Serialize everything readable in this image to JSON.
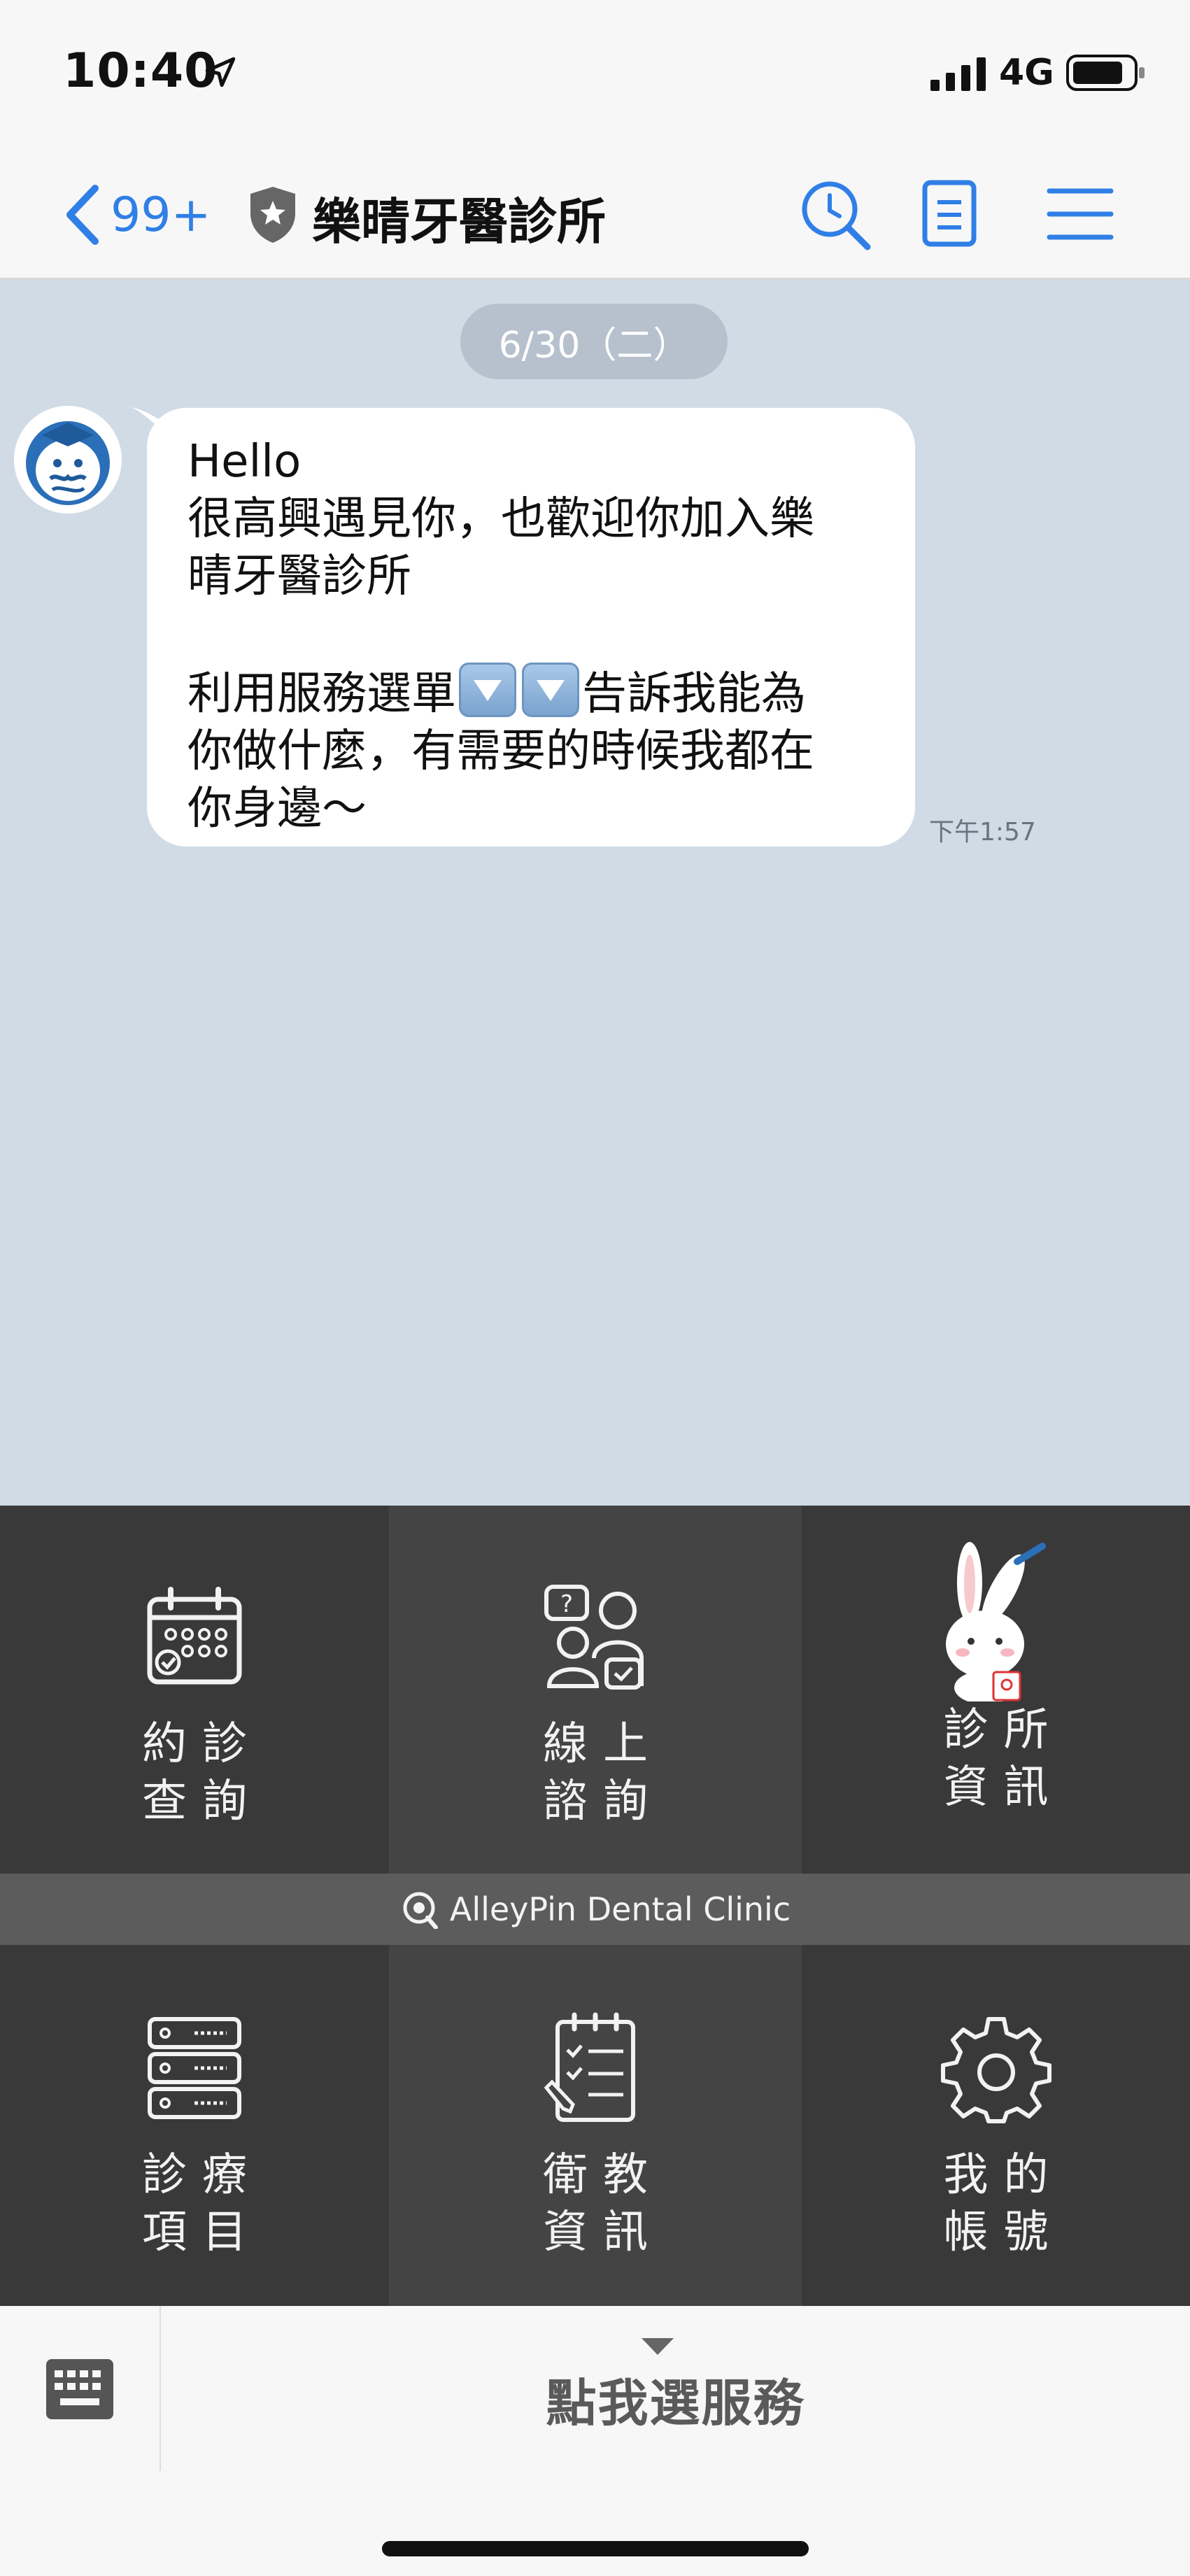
{
  "status_bar": {
    "time": "10:40",
    "network": "4G"
  },
  "nav": {
    "back_count": "99+",
    "title": "樂晴牙醫診所"
  },
  "chat": {
    "date_label": "6/30（二）",
    "message": {
      "lines": [
        "Hello",
        "很高興遇見你，也歡迎你加入樂",
        "晴牙醫診所",
        "",
        "",
        "你做什麼，有需要的時候我都在",
        "你身邊～"
      ],
      "line5_before": "利用服務選單",
      "line5_after": "告訴我能為",
      "time": "下午1:57"
    }
  },
  "rich_menu": {
    "banner": "AlleyPin Dental Clinic",
    "tiles": [
      {
        "line1": "約診",
        "line2": "查詢",
        "icon": "calendar-icon"
      },
      {
        "line1": "線上",
        "line2": "諮詢",
        "icon": "consult-icon"
      },
      {
        "line1": "診所",
        "line2": "資訊",
        "icon": "rabbit-mascot-icon"
      },
      {
        "line1": "診療",
        "line2": "項目",
        "icon": "list-icon"
      },
      {
        "line1": "衛教",
        "line2": "資訊",
        "icon": "clipboard-icon"
      },
      {
        "line1": "我的",
        "line2": "帳號",
        "icon": "gear-icon"
      }
    ]
  },
  "bottom_bar": {
    "service_label": "點我選服務"
  },
  "colors": {
    "accent_blue": "#2f7fe6",
    "chat_bg": "#d0dbe6",
    "menu_bg": "#3a3a3a"
  }
}
